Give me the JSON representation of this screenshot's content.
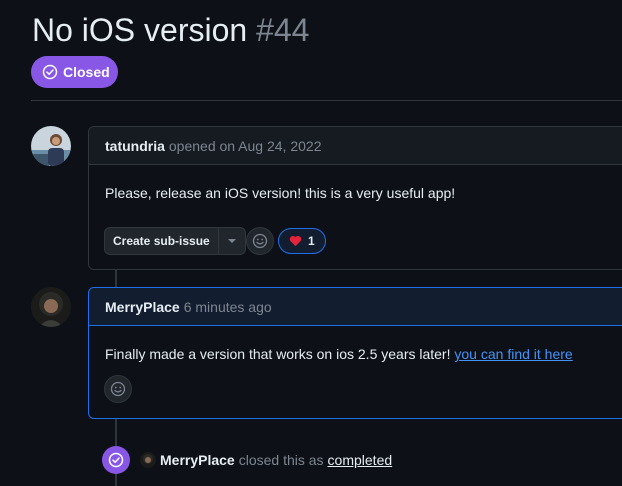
{
  "issue": {
    "title": "No iOS version",
    "number": "#44",
    "state": "Closed",
    "state_icon": "check-circle-icon"
  },
  "comments": [
    {
      "author": "tatundria",
      "meta": "opened on Aug 24, 2022",
      "body": "Please, release an iOS version! this is a very useful app!",
      "actions": {
        "sub_issue_label": "Create sub-issue",
        "reaction_emoji": "❤️",
        "reaction_count": "1"
      }
    },
    {
      "author": "MerryPlace",
      "meta": "6 minutes ago",
      "body_text": "Finally made a version that works on ios 2.5 years later! ",
      "body_link": "you can find it here"
    }
  ],
  "event": {
    "author": "MerryPlace",
    "action": "closed this as",
    "reason": "completed"
  },
  "colors": {
    "closed_purple": "#8957e5",
    "link_blue": "#4493f8",
    "background": "#0d1117"
  }
}
